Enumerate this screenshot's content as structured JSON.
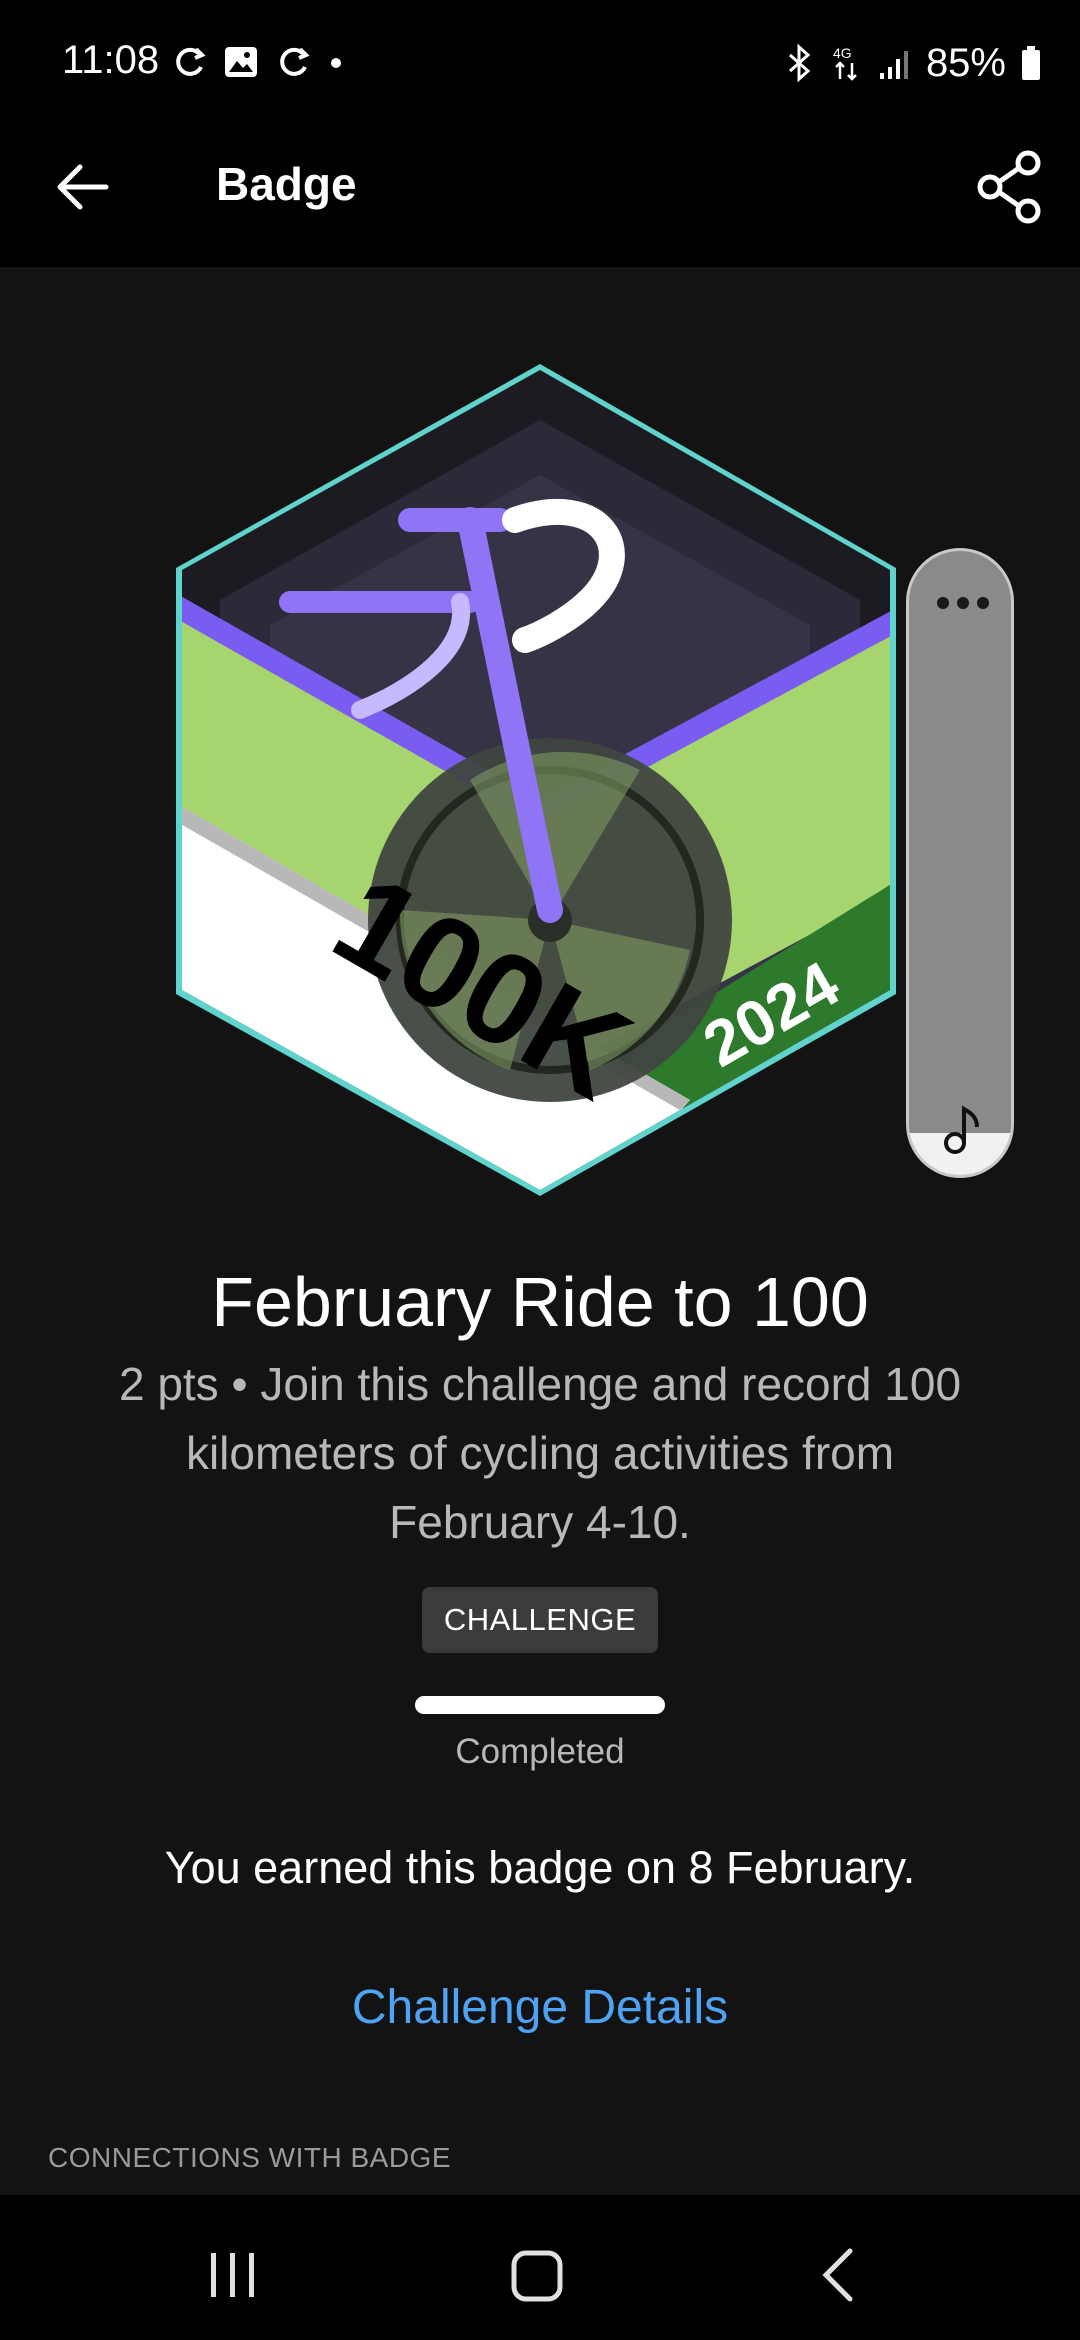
{
  "status_bar": {
    "time": "11:08",
    "battery": "85%"
  },
  "app_bar": {
    "title": "Badge"
  },
  "badge": {
    "art_text_main": "100K",
    "art_text_year": "2024",
    "title": "February Ride to 100",
    "description": "2 pts • Join this challenge and record 100 kilometers of cycling activities from February 4-10.",
    "chip": "CHALLENGE",
    "progress": 1.0,
    "progress_label": "Completed",
    "earned_text": "You earned this badge on 8 February.",
    "details_link": "Challenge Details"
  },
  "section": {
    "connections_header": "CONNECTIONS WITH BADGE"
  },
  "colors": {
    "background": "#131313",
    "link": "#4fa3f4",
    "badge_outline": "#5fd3cc",
    "badge_green": "#a6d46f",
    "badge_purple": "#7b5cf0",
    "badge_dark_green": "#2d7a2c"
  }
}
